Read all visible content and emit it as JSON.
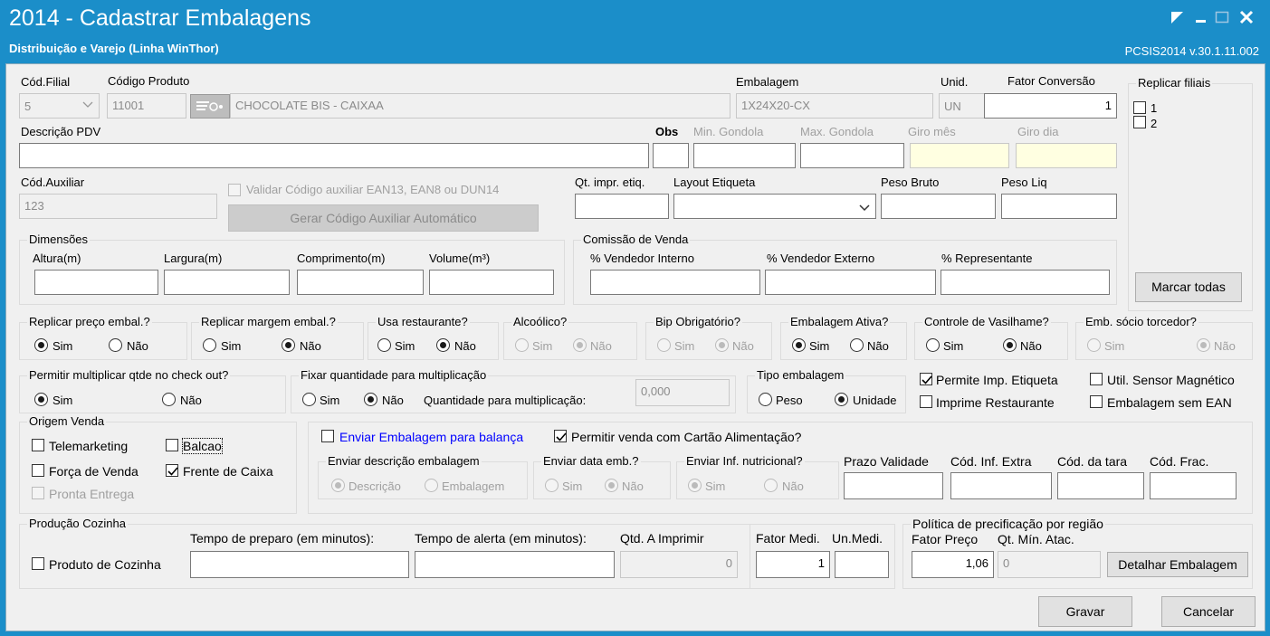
{
  "window": {
    "title": "2014 - Cadastrar Embalagens",
    "subtitle": "Distribuição e Varejo (Linha WinThor)",
    "version": "PCSIS2014  v.30.1.11.002"
  },
  "top": {
    "cod_filial_label": "Cód.Filial",
    "cod_filial_value": "5",
    "codigo_produto_label": "Código Produto",
    "codigo_produto_value": "11001",
    "produto_nome": "CHOCOLATE BIS  - CAIXAA",
    "embalagem_label": "Embalagem",
    "embalagem_value": "1X24X20-CX",
    "unid_label": "Unid.",
    "unid_value": "UN",
    "fator_conversao_label": "Fator Conversão",
    "fator_conversao_value": "1"
  },
  "replicar_filiais": {
    "title": "Replicar filiais",
    "items": [
      "1",
      "2"
    ],
    "button": "Marcar todas"
  },
  "row2": {
    "descricao_pdv_label": "Descrição PDV",
    "obs_label": "Obs",
    "min_gondola_label": "Min. Gondola",
    "max_gondola_label": "Max. Gondola",
    "giro_mes_label": "Giro mês",
    "giro_dia_label": "Giro dia"
  },
  "row3": {
    "cod_auxiliar_label": "Cód.Auxiliar",
    "cod_auxiliar_value": "123",
    "validar_label": "Validar Código auxiliar EAN13, EAN8 ou DUN14",
    "gerar_button": "Gerar Código Auxiliar Automático",
    "qt_impr_label": "Qt. impr. etiq.",
    "layout_etiqueta_label": "Layout Etiqueta",
    "peso_bruto_label": "Peso Bruto",
    "peso_liq_label": "Peso Liq"
  },
  "dimensoes": {
    "title": "Dimensões",
    "altura": "Altura(m)",
    "largura": "Largura(m)",
    "comprimento": "Comprimento(m)",
    "volume": "Volume(m³)"
  },
  "comissao": {
    "title": "Comissão de Venda",
    "interno": "% Vendedor Interno",
    "externo": "% Vendedor Externo",
    "representante": "% Representante"
  },
  "radios": {
    "sim": "Sim",
    "nao": "Não",
    "replicar_preco": "Replicar preço embal.?",
    "replicar_margem": "Replicar margem embal.?",
    "usa_restaurante": "Usa restaurante?",
    "alcoolico": "Alcoólico?",
    "bip_obrigatorio": "Bip Obrigatório?",
    "embalagem_ativa": "Embalagem Ativa?",
    "controle_vasilhame": "Controle de Vasilhame?",
    "emb_socio": "Emb. sócio torcedor?",
    "permitir_multiplicar": "Permitir multiplicar qtde no check out?",
    "fixar_quantidade": "Fixar quantidade para multiplicação",
    "quantidade_multiplicacao_label": "Quantidade para multiplicação:",
    "quantidade_multiplicacao_value": "0,000",
    "tipo_embalagem": "Tipo embalagem",
    "peso": "Peso",
    "unidade": "Unidade"
  },
  "checks": {
    "permite_imp_etiqueta": "Permite Imp. Etiqueta",
    "util_sensor": "Util. Sensor Magnético",
    "imprime_restaurante": "Imprime Restaurante",
    "embalagem_sem_ean": "Embalagem sem EAN"
  },
  "origem_venda": {
    "title": "Origem Venda",
    "telemarketing": "Telemarketing",
    "balcao": "Balcao",
    "forca_venda": "Força de Venda",
    "frente_caixa": "Frente de Caixa",
    "pronta_entrega": "Pronta Entrega"
  },
  "balanca": {
    "enviar_balanca": "Enviar Embalagem para balança",
    "permitir_cartao": "Permitir venda com Cartão Alimentação?",
    "enviar_descricao": "Enviar descrição embalagem",
    "descricao": "Descrição",
    "embalagem": "Embalagem",
    "enviar_data": "Enviar data emb.?",
    "enviar_inf": "Enviar Inf. nutricional?",
    "prazo_validade": "Prazo Validade",
    "cod_inf_extra": "Cód. Inf. Extra",
    "cod_tara": "Cód. da tara",
    "cod_frac": "Cód. Frac."
  },
  "producao": {
    "title": "Produção Cozinha",
    "produto_cozinha": "Produto de Cozinha",
    "tempo_preparo": "Tempo de preparo (em minutos):",
    "tempo_alerta": "Tempo de alerta (em minutos):",
    "qtd_imprimir": "Qtd. A Imprimir",
    "qtd_value": "0"
  },
  "fator": {
    "fator_medi": "Fator Medi.",
    "un_medi": "Un.Medi.",
    "fator_value": "1"
  },
  "politica": {
    "title": "Política de precificação por região",
    "fator_preco": "Fator Preço",
    "fator_preco_value": "1,06",
    "qt_min": "Qt. Mín. Atac.",
    "qt_min_value": "0",
    "detalhar_button": "Detalhar Embalagem"
  },
  "actions": {
    "gravar": "Gravar",
    "cancelar": "Cancelar"
  }
}
